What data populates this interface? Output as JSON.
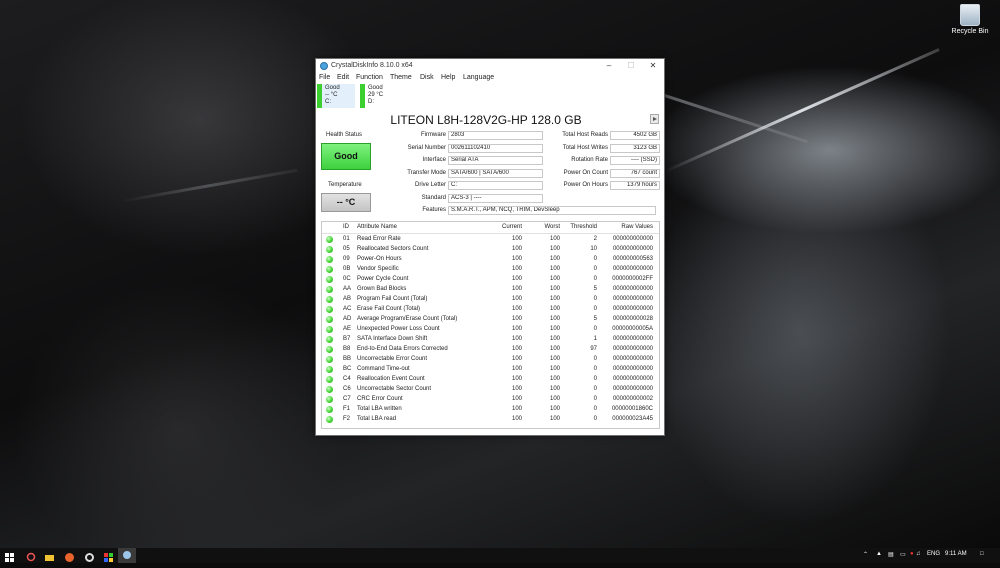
{
  "colors": {
    "good_green": "#3ccf2f",
    "accent_blue": "#4aa3df"
  },
  "desktop": {
    "recycle_bin_label": "Recycle Bin"
  },
  "window": {
    "title": "CrystalDiskInfo 8.10.0 x64",
    "menu": [
      "File",
      "Edit",
      "Function",
      "Theme",
      "Disk",
      "Help",
      "Language"
    ],
    "disks": [
      {
        "status": "Good",
        "temp": "-- °C",
        "letter": "C:"
      },
      {
        "status": "Good",
        "temp": "29 °C",
        "letter": "D:"
      }
    ],
    "model": "LITEON L8H-128V2G-HP 128.0 GB",
    "health_label": "Health Status",
    "health_value": "Good",
    "temp_label": "Temperature",
    "temp_value": "-- °C",
    "info": {
      "firmware_label": "Firmware",
      "firmware": "2803",
      "serial_label": "Serial Number",
      "serial": "002611102410",
      "interface_label": "Interface",
      "interface": "Serial ATA",
      "transfer_label": "Transfer Mode",
      "transfer": "SATA/600 | SATA/600",
      "drive_letter_label": "Drive Letter",
      "drive_letter": "C:",
      "standard_label": "Standard",
      "standard": "ACS-3 | ----",
      "features_label": "Features",
      "features": "S.M.A.R.T., APM, NCQ, TRIM, DevSleep",
      "reads_label": "Total Host Reads",
      "reads": "4502 GB",
      "writes_label": "Total Host Writes",
      "writes": "3123 GB",
      "rotation_label": "Rotation Rate",
      "rotation": "---- (SSD)",
      "power_count_label": "Power On Count",
      "power_count": "767 count",
      "power_hours_label": "Power On Hours",
      "power_hours": "1379 hours"
    },
    "table": {
      "headers": [
        "ID",
        "Attribute Name",
        "Current",
        "Worst",
        "Threshold",
        "Raw Values"
      ],
      "rows": [
        [
          "01",
          "Read Error Rate",
          "100",
          "100",
          "2",
          "000000000000"
        ],
        [
          "05",
          "Reallocated Sectors Count",
          "100",
          "100",
          "10",
          "000000000000"
        ],
        [
          "09",
          "Power-On Hours",
          "100",
          "100",
          "0",
          "000000000563"
        ],
        [
          "0B",
          "Vendor Specific",
          "100",
          "100",
          "0",
          "000000000000"
        ],
        [
          "0C",
          "Power Cycle Count",
          "100",
          "100",
          "0",
          "0000000002FF"
        ],
        [
          "AA",
          "Grown Bad Blocks",
          "100",
          "100",
          "5",
          "000000000000"
        ],
        [
          "AB",
          "Program Fail Count (Total)",
          "100",
          "100",
          "0",
          "000000000000"
        ],
        [
          "AC",
          "Erase Fail Count (Total)",
          "100",
          "100",
          "0",
          "000000000000"
        ],
        [
          "AD",
          "Average Program/Erase Count (Total)",
          "100",
          "100",
          "5",
          "000000000028"
        ],
        [
          "AE",
          "Unexpected Power Loss Count",
          "100",
          "100",
          "0",
          "00000000005A"
        ],
        [
          "B7",
          "SATA Interface Down Shift",
          "100",
          "100",
          "1",
          "000000000000"
        ],
        [
          "B8",
          "End-to-End Data Errors Corrected",
          "100",
          "100",
          "97",
          "000000000000"
        ],
        [
          "BB",
          "Uncorrectable Error Count",
          "100",
          "100",
          "0",
          "000000000000"
        ],
        [
          "BC",
          "Command Time-out",
          "100",
          "100",
          "0",
          "000000000000"
        ],
        [
          "C4",
          "Reallocation Event Count",
          "100",
          "100",
          "0",
          "000000000000"
        ],
        [
          "C6",
          "Uncorrectable Sector Count",
          "100",
          "100",
          "0",
          "000000000000"
        ],
        [
          "C7",
          "CRC Error Count",
          "100",
          "100",
          "0",
          "000000000002"
        ],
        [
          "F1",
          "Total LBA written",
          "100",
          "100",
          "0",
          "00000001860C"
        ],
        [
          "F2",
          "Total LBA read",
          "100",
          "100",
          "0",
          "000000023A45"
        ]
      ]
    }
  },
  "taskbar": {
    "language": "ENG",
    "time": "9:11 AM"
  }
}
